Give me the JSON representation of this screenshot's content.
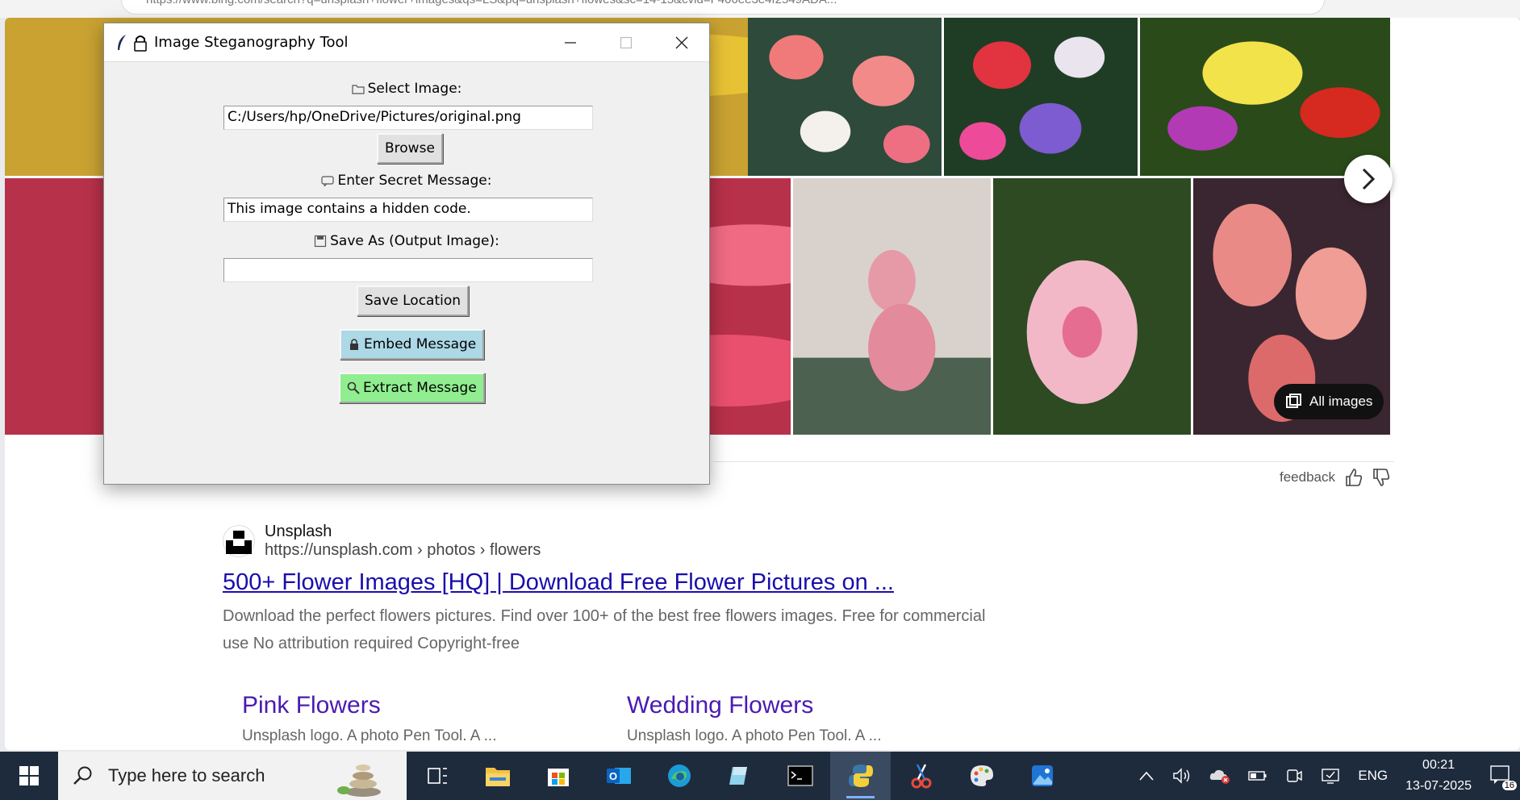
{
  "browser": {
    "address_text": "https://www.bing.com/search?q=unsplash+flower+images&qs=LS&pq=unsplash+flowes&sc=14-15&cvid=F406ee3e4f2549ADA..."
  },
  "images": {
    "next_label": "›",
    "all_images_label": "All images",
    "feedback_label": "feedback"
  },
  "result": {
    "source_name": "Unsplash",
    "source_url": "https://unsplash.com › photos › flowers",
    "title": "500+ Flower Images [HQ] | Download Free Flower Pictures on ...",
    "snippet": "Download the perfect flowers pictures. Find over 100+ of the best free flowers images. Free for commercial use No attribution required Copyright-free",
    "deep_links": [
      {
        "title": "Pink Flowers",
        "subtitle": "Unsplash logo. A photo Pen Tool. A ..."
      },
      {
        "title": "Wedding Flowers",
        "subtitle": "Unsplash logo. A photo Pen Tool. A ..."
      }
    ]
  },
  "tk_window": {
    "title": "Image Steganography Tool",
    "select_label": "Select Image:",
    "image_path": "C:/Users/hp/OneDrive/Pictures/original.png",
    "browse_label": "Browse",
    "message_label": "Enter Secret Message:",
    "message_value": "This image contains a hidden code.",
    "save_as_label": "Save As (Output Image):",
    "output_path": "",
    "save_location_label": "Save Location",
    "embed_label": "Embed Message",
    "extract_label": "Extract Message",
    "colors": {
      "embed": "#add8e6",
      "extract": "#90ee90"
    }
  },
  "taskbar": {
    "search_placeholder": "Type here to search",
    "apps": [
      "task-view",
      "file-explorer",
      "microsoft-store",
      "outlook",
      "edge",
      "notepad-plus",
      "terminal",
      "python",
      "snipping-tool",
      "paint",
      "photos"
    ],
    "language": "ENG",
    "time": "00:21",
    "date": "13-07-2025",
    "notification_count": "16"
  }
}
